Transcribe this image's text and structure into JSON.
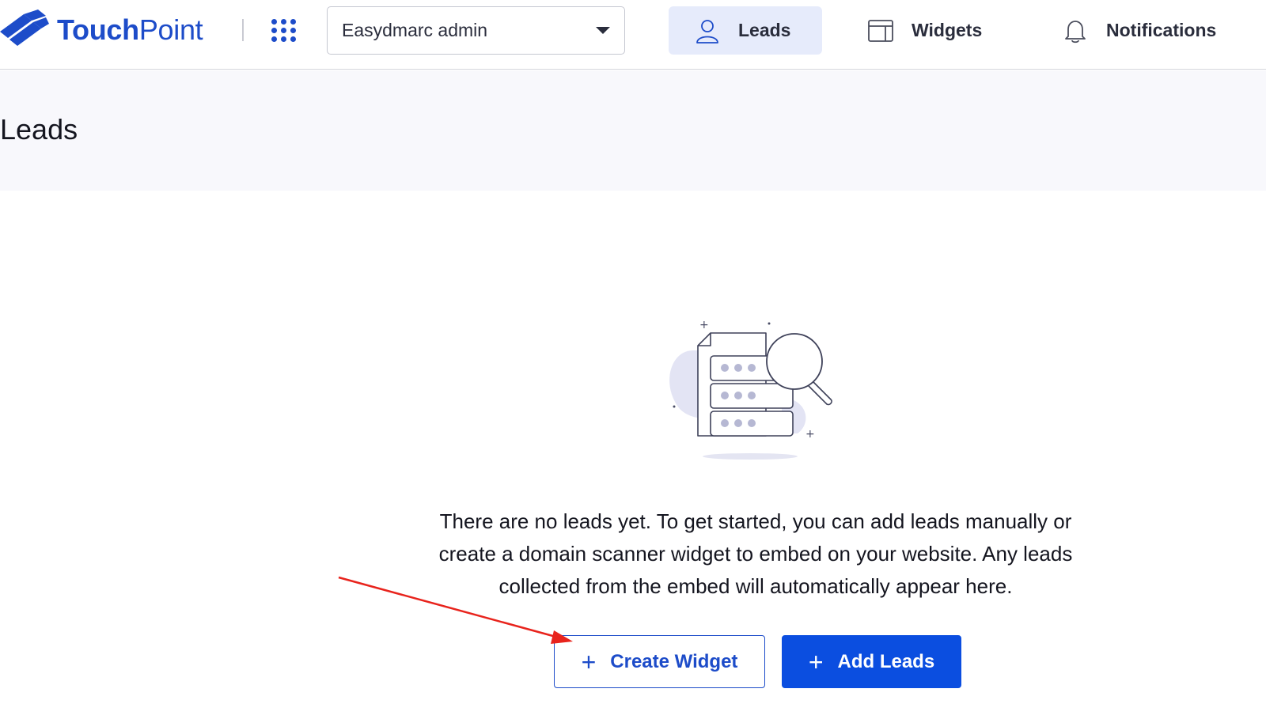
{
  "brand": {
    "name_bold": "Touch",
    "name_light": "Point",
    "color": "#1d4cc9"
  },
  "header": {
    "apps_icon": "grid-icon",
    "account_select": {
      "value": "Easydmarc admin"
    },
    "nav": {
      "leads": "Leads",
      "widgets": "Widgets",
      "notifications": "Notifications"
    }
  },
  "page": {
    "title": "Leads"
  },
  "empty_state": {
    "illustration_icon": "document-search-icon",
    "message": "There are no leads yet. To get started, you can add leads manually or create a domain scanner widget to embed on your website. Any leads collected from the embed will automatically appear here.",
    "buttons": {
      "create_widget": "Create Widget",
      "add_leads": "Add Leads"
    }
  },
  "colors": {
    "accent": "#1d4cc9",
    "primary_button": "#0b4ee0",
    "active_nav_bg": "#e6ebfb",
    "annotation_arrow": "#e8231c"
  }
}
